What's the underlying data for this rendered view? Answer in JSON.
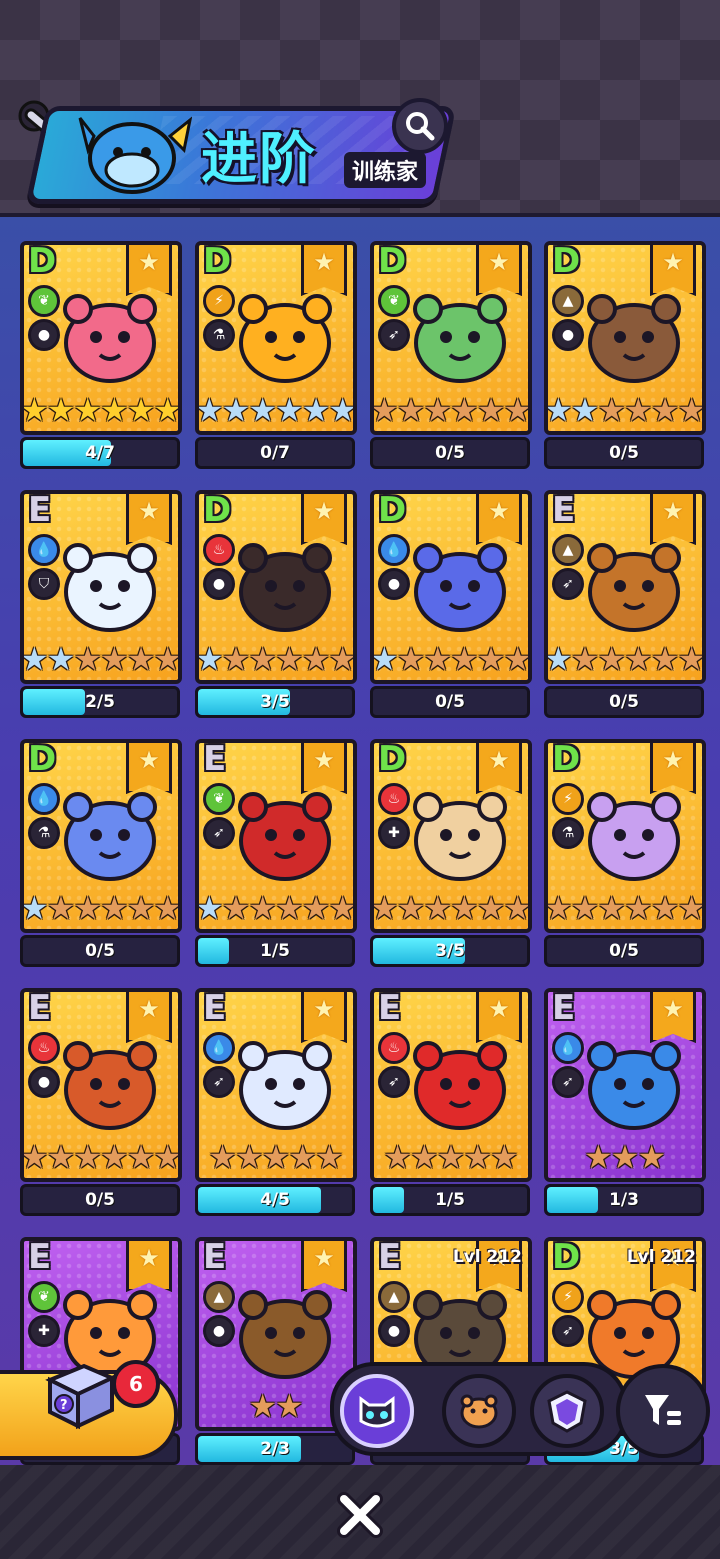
{
  "header": {
    "title": "进阶",
    "subtitle": "训练家",
    "search_icon": "search-icon"
  },
  "colors": {
    "element_grass": "#5fc43a",
    "element_electric": "#f0a21a",
    "element_earth": "#8a6a3a",
    "element_water": "#3a8ae8",
    "element_fire": "#e8343a",
    "progress_fill": "#3fd8f0",
    "card_gold": "#ffc23a",
    "card_purple": "#a24ae0"
  },
  "cards": [
    {
      "rank": "D",
      "element": "grass",
      "role": "balloon",
      "bg": "gold",
      "stars": [
        "gold",
        "gold",
        "gold",
        "gold",
        "gold",
        "gold"
      ],
      "progress_text": "4/7",
      "progress": 0.57,
      "creature_color": "#f26a8a",
      "lvl": ""
    },
    {
      "rank": "D",
      "element": "electric",
      "role": "flask",
      "bg": "gold",
      "stars": [
        "silver",
        "silver",
        "silver",
        "silver",
        "silver",
        "silver"
      ],
      "progress_text": "0/7",
      "progress": 0,
      "creature_color": "#ffb020",
      "lvl": ""
    },
    {
      "rank": "D",
      "element": "grass",
      "role": "run",
      "bg": "gold",
      "stars": [
        "bronze",
        "bronze",
        "bronze",
        "bronze",
        "bronze",
        "bronze"
      ],
      "progress_text": "0/5",
      "progress": 0,
      "creature_color": "#6cc46a",
      "lvl": ""
    },
    {
      "rank": "D",
      "element": "earth",
      "role": "balloon",
      "bg": "gold",
      "stars": [
        "silver",
        "silver",
        "bronze",
        "bronze",
        "bronze",
        "bronze"
      ],
      "progress_text": "0/5",
      "progress": 0,
      "creature_color": "#8a5a3a",
      "lvl": ""
    },
    {
      "rank": "E",
      "element": "water",
      "role": "shield",
      "bg": "gold",
      "stars": [
        "silver",
        "silver",
        "bronze",
        "bronze",
        "bronze",
        "bronze"
      ],
      "progress_text": "2/5",
      "progress": 0.4,
      "creature_color": "#eaf4ff",
      "lvl": ""
    },
    {
      "rank": "D",
      "element": "fire",
      "role": "balloon",
      "bg": "gold",
      "stars": [
        "silver",
        "bronze",
        "bronze",
        "bronze",
        "bronze",
        "bronze"
      ],
      "progress_text": "3/5",
      "progress": 0.6,
      "creature_color": "#3a2a2a",
      "lvl": ""
    },
    {
      "rank": "D",
      "element": "water",
      "role": "balloon",
      "bg": "gold",
      "stars": [
        "silver",
        "bronze",
        "bronze",
        "bronze",
        "bronze",
        "bronze"
      ],
      "progress_text": "0/5",
      "progress": 0,
      "creature_color": "#5a6ae8",
      "lvl": ""
    },
    {
      "rank": "E",
      "element": "earth",
      "role": "run",
      "bg": "gold",
      "stars": [
        "silver",
        "bronze",
        "bronze",
        "bronze",
        "bronze",
        "bronze"
      ],
      "progress_text": "0/5",
      "progress": 0,
      "creature_color": "#c4742a",
      "lvl": ""
    },
    {
      "rank": "D",
      "element": "water",
      "role": "flask",
      "bg": "gold",
      "stars": [
        "silver",
        "bronze",
        "bronze",
        "bronze",
        "bronze",
        "bronze"
      ],
      "progress_text": "0/5",
      "progress": 0,
      "creature_color": "#6a8af0",
      "lvl": ""
    },
    {
      "rank": "E",
      "element": "grass",
      "role": "run",
      "bg": "gold",
      "stars": [
        "silver",
        "bronze",
        "bronze",
        "bronze",
        "bronze",
        "bronze"
      ],
      "progress_text": "1/5",
      "progress": 0.2,
      "creature_color": "#d02a2a",
      "lvl": ""
    },
    {
      "rank": "D",
      "element": "fire",
      "role": "heal",
      "bg": "gold",
      "stars": [
        "bronze",
        "bronze",
        "bronze",
        "bronze",
        "bronze",
        "bronze"
      ],
      "progress_text": "3/5",
      "progress": 0.6,
      "creature_color": "#f0d0a0",
      "lvl": ""
    },
    {
      "rank": "D",
      "element": "electric",
      "role": "flask",
      "bg": "gold",
      "stars": [
        "bronze",
        "bronze",
        "bronze",
        "bronze",
        "bronze",
        "bronze"
      ],
      "progress_text": "0/5",
      "progress": 0,
      "creature_color": "#c8a0f0",
      "lvl": ""
    },
    {
      "rank": "E",
      "element": "fire",
      "role": "balloon",
      "bg": "gold",
      "stars": [
        "bronze",
        "bronze",
        "bronze",
        "bronze",
        "bronze",
        "bronze"
      ],
      "progress_text": "0/5",
      "progress": 0,
      "creature_color": "#d85a2a",
      "lvl": ""
    },
    {
      "rank": "E",
      "element": "water",
      "role": "run",
      "bg": "gold",
      "stars": [
        "bronze",
        "bronze",
        "bronze",
        "bronze",
        "bronze"
      ],
      "progress_text": "4/5",
      "progress": 0.8,
      "creature_color": "#e0eaff",
      "lvl": ""
    },
    {
      "rank": "E",
      "element": "fire",
      "role": "run",
      "bg": "gold",
      "stars": [
        "bronze",
        "bronze",
        "bronze",
        "bronze",
        "bronze"
      ],
      "progress_text": "1/5",
      "progress": 0.2,
      "creature_color": "#e02a2a",
      "lvl": ""
    },
    {
      "rank": "E",
      "element": "water",
      "role": "run",
      "bg": "purple",
      "stars": [
        "bronze",
        "bronze",
        "bronze"
      ],
      "progress_text": "1/3",
      "progress": 0.33,
      "creature_color": "#3a8ae8",
      "lvl": ""
    },
    {
      "rank": "E",
      "element": "grass",
      "role": "heal",
      "bg": "purple",
      "stars": [
        "bronze",
        "bronze"
      ],
      "progress_text": "",
      "progress": 0,
      "creature_color": "#ff9a3a",
      "lvl": ""
    },
    {
      "rank": "E",
      "element": "earth",
      "role": "balloon",
      "bg": "purple",
      "stars": [
        "bronze",
        "bronze"
      ],
      "progress_text": "2/3",
      "progress": 0.67,
      "creature_color": "#8a5a2a",
      "lvl": ""
    },
    {
      "rank": "E",
      "element": "earth",
      "role": "balloon",
      "bg": "gold",
      "stars": [],
      "progress_text": "",
      "progress": 0,
      "creature_color": "#5a4a3a",
      "lvl": "Lvl 212"
    },
    {
      "rank": "D",
      "element": "electric",
      "role": "run",
      "bg": "gold",
      "stars": [],
      "progress_text": "3/5",
      "progress": 0.6,
      "creature_color": "#f07a2a",
      "lvl": "Lvl 212"
    }
  ],
  "mystery_box": {
    "count": "6",
    "icon": "mystery-box-icon"
  },
  "tabs": [
    {
      "icon": "cat-mask-icon",
      "active": true
    },
    {
      "icon": "pet-face-icon",
      "active": false
    },
    {
      "icon": "shield-face-icon",
      "active": false
    }
  ],
  "filter": {
    "icon": "filter-icon"
  },
  "footer": {
    "close_icon": "close-icon"
  }
}
